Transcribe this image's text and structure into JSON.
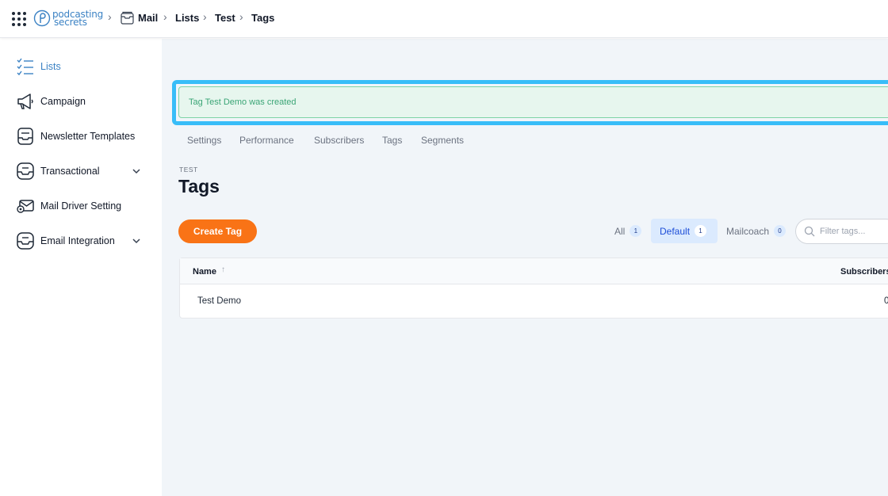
{
  "topbar": {
    "logo": {
      "line1": "podcasting",
      "line2": "secrets"
    },
    "breadcrumbs": [
      "Mail",
      "Lists",
      "Test",
      "Tags"
    ]
  },
  "sidebar": {
    "items": [
      {
        "label": "Lists",
        "icon": "list-check-icon",
        "active": true
      },
      {
        "label": "Campaign",
        "icon": "megaphone-icon"
      },
      {
        "label": "Newsletter Templates",
        "icon": "template-icon"
      },
      {
        "label": "Transactional",
        "icon": "inbox-icon",
        "expandable": true
      },
      {
        "label": "Mail Driver Setting",
        "icon": "mail-gear-icon"
      },
      {
        "label": "Email Integration",
        "icon": "inbox-icon",
        "expandable": true
      }
    ]
  },
  "alert": {
    "message": "Tag Test Demo was created"
  },
  "tabs": [
    "Settings",
    "Performance",
    "Subscribers",
    "Tags",
    "Segments"
  ],
  "header": {
    "eyebrow": "TEST",
    "title": "Tags"
  },
  "actions": {
    "create_label": "Create Tag"
  },
  "filters": [
    {
      "label": "All",
      "count": "1"
    },
    {
      "label": "Default",
      "count": "1",
      "active": true
    },
    {
      "label": "Mailcoach",
      "count": "0"
    }
  ],
  "search": {
    "placeholder": "Filter tags..."
  },
  "table": {
    "columns": [
      "Name",
      "Subscribers"
    ],
    "rows": [
      {
        "name": "Test Demo",
        "subscribers": "0"
      }
    ]
  },
  "colors": {
    "accent": "#3b82c4",
    "cta": "#f97316",
    "success_bg": "#e7f6ee",
    "highlight": "#38bdf8"
  }
}
